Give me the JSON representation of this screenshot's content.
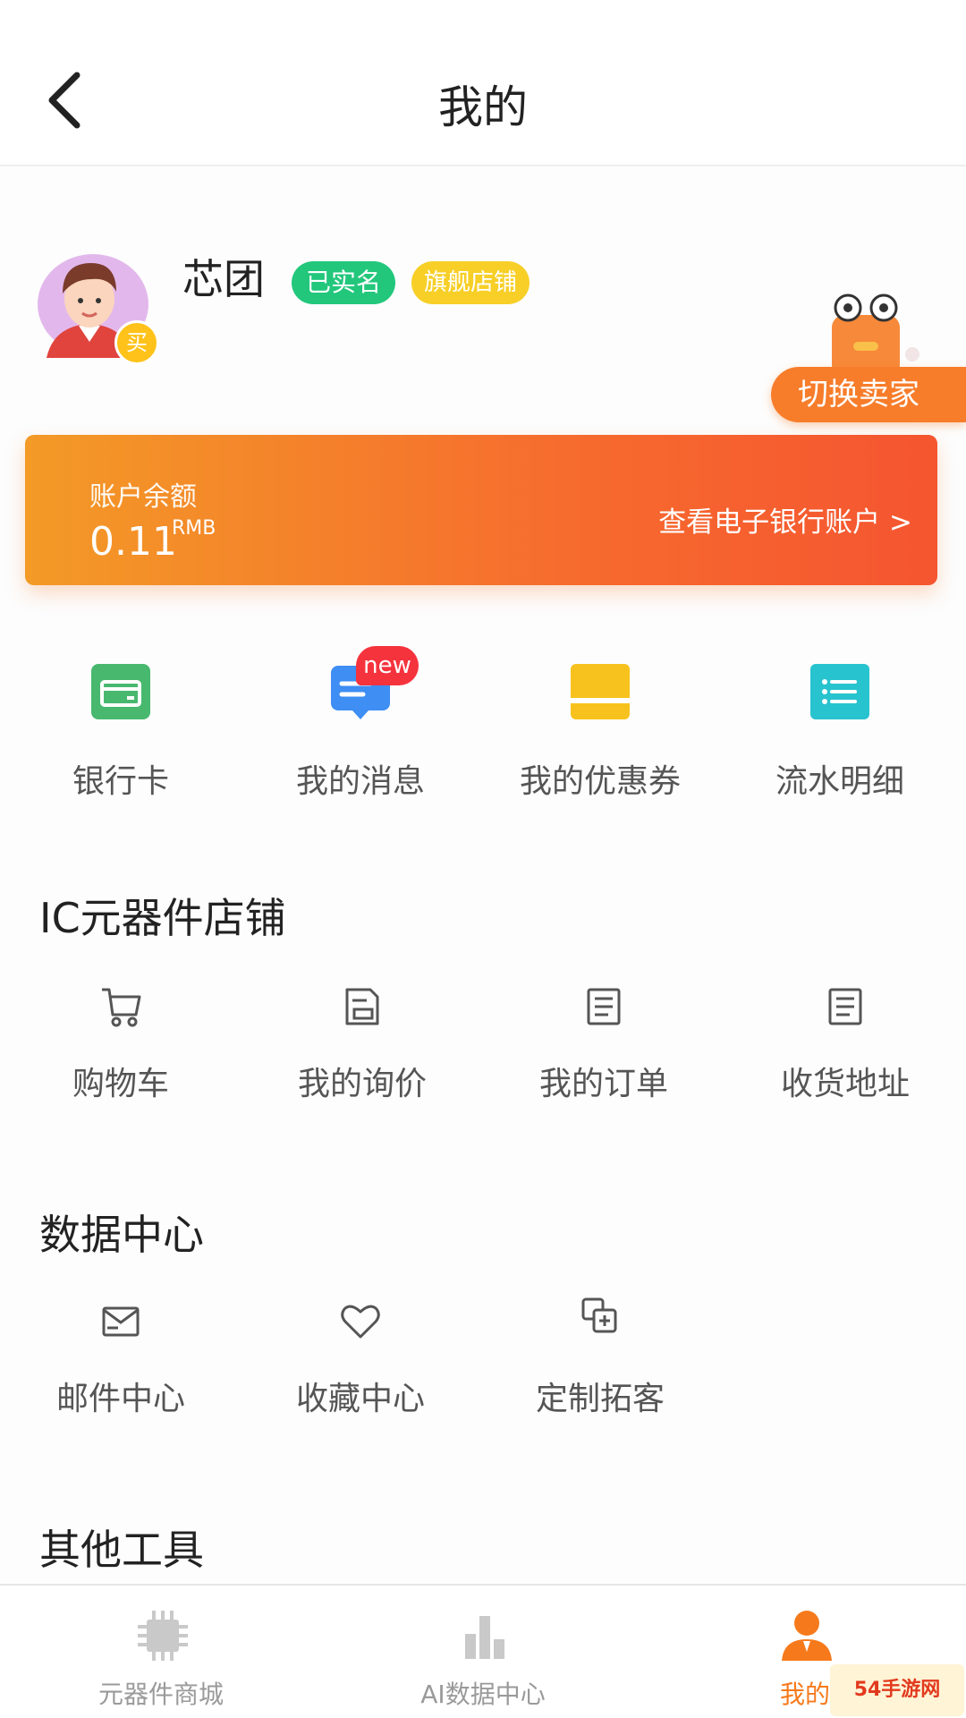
{
  "header": {
    "title": "我的",
    "back_icon": "chevron-left-icon"
  },
  "profile": {
    "name": "芯团",
    "avatar_badge": "买",
    "badges": {
      "verified": "已实名",
      "flagship": "旗舰店铺"
    },
    "switch_label": "切换卖家"
  },
  "balance": {
    "label": "账户余额",
    "value": "0.11",
    "unit": "RMB",
    "link_label": "查看电子银行账户 >"
  },
  "quick_actions": [
    {
      "label": "银行卡",
      "icon": "bank-card-icon",
      "color": "#48b86e"
    },
    {
      "label": "我的消息",
      "icon": "message-icon",
      "color": "#3e8ef3",
      "badge": "new"
    },
    {
      "label": "我的优惠券",
      "icon": "coupon-icon",
      "color": "#f7c21d"
    },
    {
      "label": "流水明细",
      "icon": "list-detail-icon",
      "color": "#27c3cf"
    }
  ],
  "sections": {
    "ic_store": {
      "title": "IC元器件店铺",
      "items": [
        {
          "label": "购物车",
          "icon": "cart-icon"
        },
        {
          "label": "我的询价",
          "icon": "inquiry-icon"
        },
        {
          "label": "我的订单",
          "icon": "order-icon"
        },
        {
          "label": "收货地址",
          "icon": "address-icon"
        }
      ]
    },
    "data_center": {
      "title": "数据中心",
      "items": [
        {
          "label": "邮件中心",
          "icon": "mail-icon"
        },
        {
          "label": "收藏中心",
          "icon": "heart-icon"
        },
        {
          "label": "定制拓客",
          "icon": "custom-icon"
        }
      ]
    },
    "other_tools": {
      "title": "其他工具"
    }
  },
  "bottom_nav": [
    {
      "label": "元器件商城",
      "icon": "chip-icon",
      "active": false
    },
    {
      "label": "AI数据中心",
      "icon": "bar-chart-icon",
      "active": false
    },
    {
      "label": "我的",
      "icon": "user-icon",
      "active": true
    }
  ],
  "colors": {
    "accent": "#f67a1c",
    "verified": "#22c77c",
    "flagship": "#f7cf27"
  },
  "watermark": "54手游网"
}
